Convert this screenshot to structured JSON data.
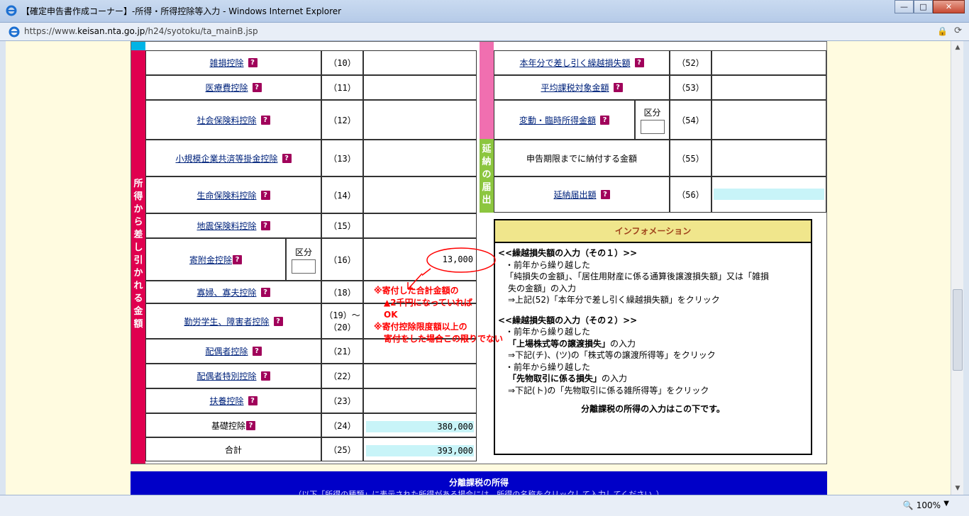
{
  "window": {
    "title": "【確定申告書作成コーナー】-所得・所得控除等入力 - Windows Internet Explorer",
    "url_prefix": "https://www.",
    "url_domain": "keisan.nta.go.jp",
    "url_path": "/h24/syotoku/ta_mainB.jsp",
    "zoom": "100%",
    "minimize": "—",
    "maximize": "□",
    "close": "✕"
  },
  "left_side_label": [
    "所",
    "得",
    "か",
    "ら",
    "差",
    "し",
    "引",
    "か",
    "れ",
    "る",
    "金",
    "額"
  ],
  "right_side_label": [
    "延",
    "納",
    "の",
    "届",
    "出"
  ],
  "help_glyph": "?",
  "deductions": [
    {
      "label": "雑損控除",
      "num": "（10）"
    },
    {
      "label": "医療費控除",
      "num": "（11）"
    },
    {
      "label": "社会保険料控除",
      "num": "（12）"
    },
    {
      "label": "小規模企業共済等掛金控除",
      "num": "（13）"
    },
    {
      "label": "生命保険料控除",
      "num": "（14）"
    },
    {
      "label": "地震保険料控除",
      "num": "（15）"
    },
    {
      "label": "寄附金控除",
      "num": "（16）",
      "value": "13,000"
    },
    {
      "label": "寡婦、寡夫控除",
      "num": "（18）"
    },
    {
      "label": "勤労学生、障害者控除",
      "num": "（19）〜",
      "num2": "（20）"
    },
    {
      "label": "配偶者控除",
      "num": "（21）"
    },
    {
      "label": "配偶者特別控除",
      "num": "（22）"
    },
    {
      "label": "扶養控除",
      "num": "（23）"
    },
    {
      "label": "基礎控除",
      "num": "（24）",
      "value": "380,000"
    },
    {
      "label": "合計",
      "num": "（25）",
      "value": "393,000"
    }
  ],
  "kubun_label": "区分",
  "right_rows": [
    {
      "label": "本年分で差し引く繰越損失額",
      "num": "（52）"
    },
    {
      "label": "平均課税対象金額",
      "num": "（53）"
    },
    {
      "label": "変動・臨時所得金額",
      "num": "（54）"
    },
    {
      "label": "申告期限までに納付する金額",
      "num": "（55）"
    },
    {
      "label": "延納届出額",
      "num": "（56）"
    }
  ],
  "annotation": {
    "line1": "※寄付した合計金額の",
    "line2": "▲2千円になっていれば",
    "line3": "OK",
    "line4": "※寄付控除限度額以上の",
    "line5": "寄付をした場合この限りでない"
  },
  "info": {
    "header": "インフォメーション",
    "s1_title": "<<繰越損失額の入力（その１）>>",
    "s1_l1": "・前年から繰り越した",
    "s1_l2": "「純損失の金額」、「居住用財産に係る通算後譲渡損失額」又は「雑損",
    "s1_l3": "失の金額」の入力",
    "s1_l4": "⇒上記(52)「本年分で差し引く繰越損失額」をクリック",
    "s2_title": "<<繰越損失額の入力（その２）>>",
    "s2_l1": "・前年から繰り越した",
    "s2_l2a": "「上場株式等の譲渡損失」",
    "s2_l2b": "の入力",
    "s2_l3": "⇒下記(チ)、(ツ)の「株式等の譲渡所得等」をクリック",
    "s2_l4": "・前年から繰り越した",
    "s2_l5a": "「先物取引に係る損失」",
    "s2_l5b": "の入力",
    "s2_l6": "⇒下記(ト)の「先物取引に係る雑所得等」をクリック",
    "footer": "分離課税の所得の入力はこの下です。"
  },
  "bottom": {
    "title": "分離課税の所得",
    "subtitle": "（以下「所得の種類」に表示された所得がある場合には、所得の名称をクリックして入力してください。）"
  },
  "colors": {
    "pink": "#e0004f",
    "magenta": "#f06fb0",
    "green": "#8cc63f",
    "cyan_field": "#c8f4f8",
    "blue_bar": "#0000c8"
  }
}
